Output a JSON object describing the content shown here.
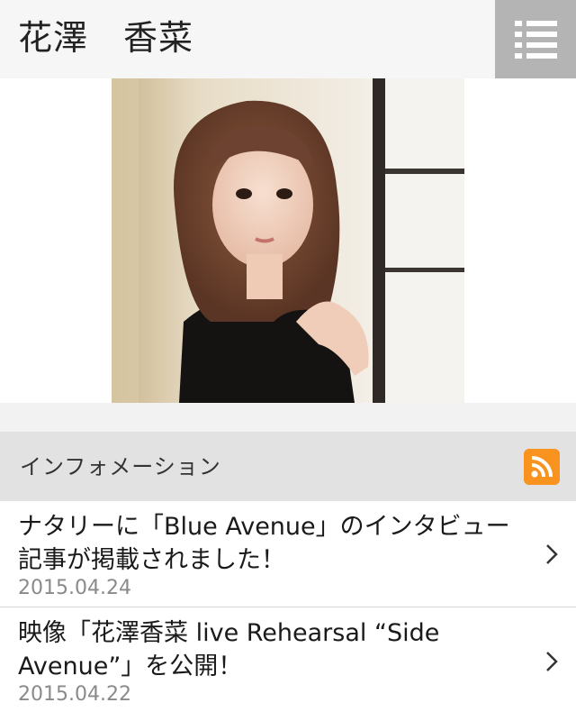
{
  "header": {
    "title": "花澤　香菜",
    "menu_icon": "list-menu-icon"
  },
  "hero": {
    "image": "artist-portrait"
  },
  "info": {
    "title": "インフォメーション",
    "rss_icon": "rss-feed-icon",
    "rss_color": "#f7931e"
  },
  "news": [
    {
      "title": "ナタリーに「Blue Avenue」のインタビュー記事が掲載されました！",
      "date": "2015.04.24"
    },
    {
      "title": "映像「花澤香菜 live Rehearsal “Side Avenue”」を公開！",
      "date": "2015.04.22"
    }
  ]
}
